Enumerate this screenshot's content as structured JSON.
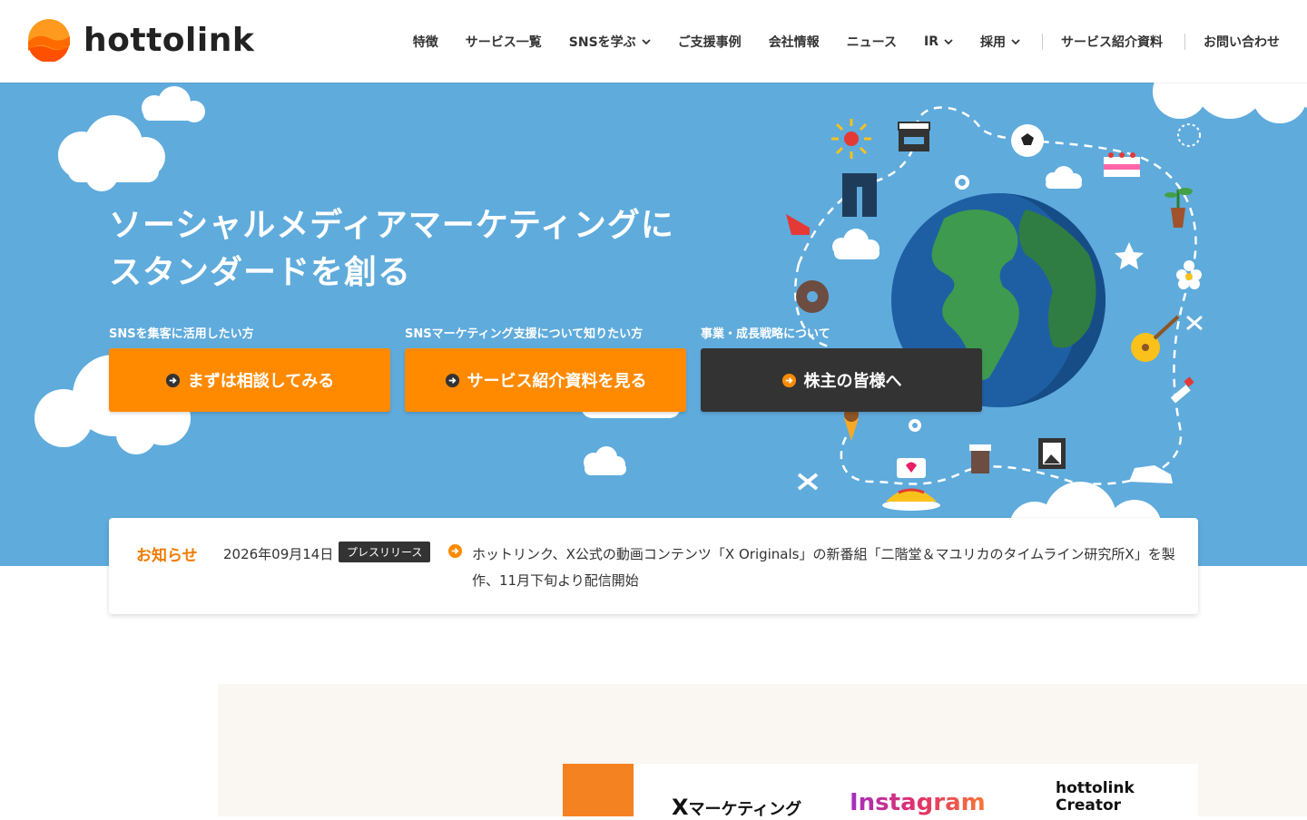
{
  "header": {
    "logo_text": "hottolink",
    "nav": [
      {
        "label": "特徴",
        "dropdown": false
      },
      {
        "label": "サービス一覧",
        "dropdown": false
      },
      {
        "label": "SNSを学ぶ",
        "dropdown": true
      },
      {
        "label": "ご支援事例",
        "dropdown": false
      },
      {
        "label": "会社情報",
        "dropdown": false
      },
      {
        "label": "ニュース",
        "dropdown": false
      },
      {
        "label": "IR",
        "dropdown": true
      },
      {
        "label": "採用",
        "dropdown": true
      }
    ],
    "nav_secondary": [
      {
        "label": "サービス紹介資料"
      },
      {
        "label": "お問い合わせ"
      }
    ]
  },
  "hero": {
    "title_line1": "ソーシャルメディアマーケティングに",
    "title_line2": "スタンダードを創る",
    "ctas": [
      {
        "caption": "SNSを集客に活用したい方",
        "label": "まずは相談してみる",
        "style": "orange"
      },
      {
        "caption": "SNSマーケティング支援について知りたい方",
        "label": "サービス紹介資料を見る",
        "style": "orange"
      },
      {
        "caption": "事業・成長戦略について",
        "label": "株主の皆様へ",
        "style": "dark"
      }
    ]
  },
  "news": {
    "heading": "お知らせ",
    "date": "2026年09月14日",
    "badge": "プレスリリース",
    "text": "ホットリンク、X公式の動画コンテンツ「X Originals」の新番組「二階堂＆マユリカのタイムライン研究所X」を製作、11月下旬より配信開始"
  },
  "services": {
    "x_marketing_big": "X",
    "x_marketing_small": "マーケティング",
    "instagram": "Instagram",
    "creator_line1": "hottolink",
    "creator_line2": "Creator"
  },
  "colors": {
    "hero_bg": "#5fabdc",
    "accent_orange": "#ff8a00",
    "dark_button": "#333333",
    "news_heading": "#ef7b00"
  },
  "icons": [
    "logo-mark-icon",
    "chevron-down-icon",
    "arrow-circle-icon",
    "globe-illustration",
    "cloud-icon"
  ]
}
